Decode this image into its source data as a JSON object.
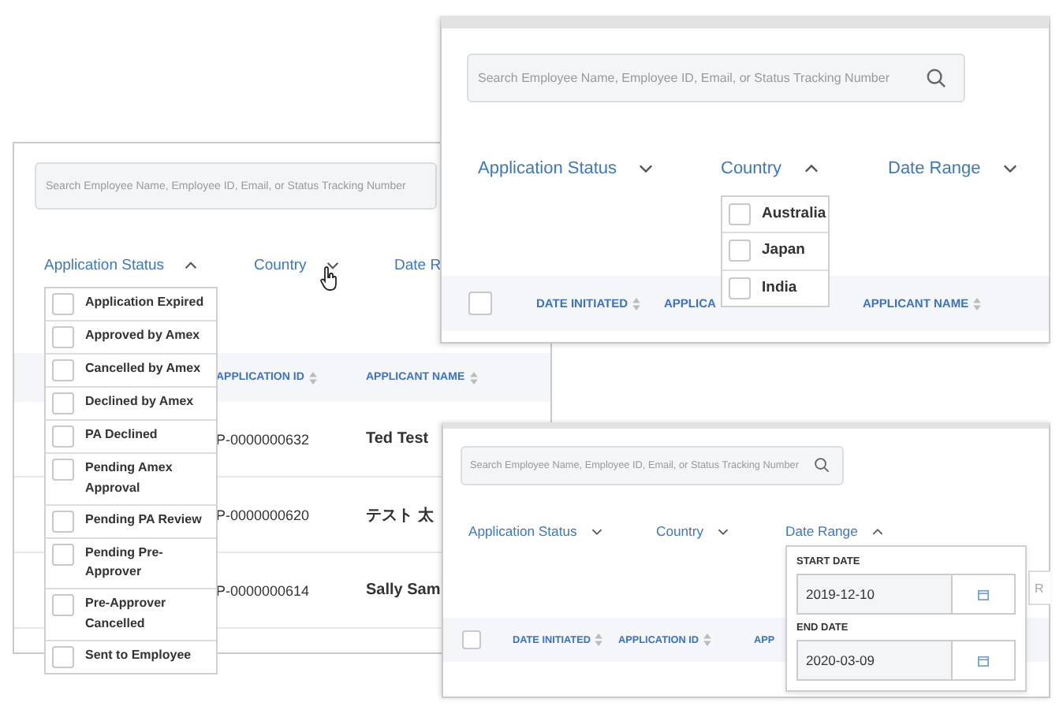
{
  "panels": [
    {
      "search": {
        "placeholder": "Search Employee Name, Employee ID, Email, or Status Tracking Number"
      },
      "filters": [
        {
          "label": "Application Status",
          "expanded": true
        },
        {
          "label": "Country",
          "expanded": false
        },
        {
          "label": "Date R"
        }
      ],
      "columns": [
        {
          "label": "APPLICATION ID",
          "sortable": true
        },
        {
          "label": "APPLICANT NAME",
          "sortable": true
        }
      ],
      "rows": [
        {
          "application_id": "P-0000000632",
          "applicant_name": "Ted Test"
        },
        {
          "application_id": "P-0000000620",
          "applicant_name": "テスト 太"
        },
        {
          "application_id": "P-0000000614",
          "applicant_name": "Sally Sam"
        }
      ],
      "popup": {
        "kind": "checklist",
        "options": [
          {
            "label": "Application Expired",
            "checked": false
          },
          {
            "label": "Approved by Amex",
            "checked": false
          },
          {
            "label": "Cancelled by Amex",
            "checked": false
          },
          {
            "label": "Declined by Amex",
            "checked": false
          },
          {
            "label": "PA Declined",
            "checked": false
          },
          {
            "label": "Pending Amex Approval",
            "checked": false
          },
          {
            "label": "Pending PA Review",
            "checked": false
          },
          {
            "label": "Pending Pre-Approver",
            "checked": false
          },
          {
            "label": "Pre-Approver Cancelled",
            "checked": false
          },
          {
            "label": "Sent to Employee",
            "checked": false
          }
        ]
      }
    },
    {
      "search": {
        "placeholder": "Search Employee Name, Employee ID, Email, or Status Tracking Number"
      },
      "filters": [
        {
          "label": "Application Status",
          "expanded": false
        },
        {
          "label": "Country",
          "expanded": true
        },
        {
          "label": "Date Range",
          "expanded": false
        }
      ],
      "select_all": {
        "checked": false
      },
      "columns": [
        {
          "label": "DATE INITIATED",
          "sortable": true
        },
        {
          "label": "APPLICA",
          "sortable": false
        },
        {
          "label": "APPLICANT NAME",
          "sortable": true
        }
      ],
      "popup": {
        "kind": "checklist",
        "options": [
          {
            "label": "Australia",
            "checked": false
          },
          {
            "label": "Japan",
            "checked": false
          },
          {
            "label": "India",
            "checked": false
          }
        ]
      }
    },
    {
      "search": {
        "placeholder": "Search Employee Name, Employee ID, Email, or Status Tracking Number"
      },
      "filters": [
        {
          "label": "Application Status",
          "expanded": false
        },
        {
          "label": "Country",
          "expanded": false
        },
        {
          "label": "Date Range",
          "expanded": true
        }
      ],
      "select_all": {
        "checked": false
      },
      "partial_field": {
        "placeholder": "R"
      },
      "columns": [
        {
          "label": "DATE INITIATED",
          "sortable": true
        },
        {
          "label": "APPLICATION ID",
          "sortable": true
        },
        {
          "label": "APP",
          "sortable": false
        }
      ],
      "popup": {
        "kind": "date_range",
        "fields": [
          {
            "label": "START DATE",
            "value": "2019-12-10"
          },
          {
            "label": "END DATE",
            "value": "2020-03-09"
          }
        ]
      }
    }
  ]
}
